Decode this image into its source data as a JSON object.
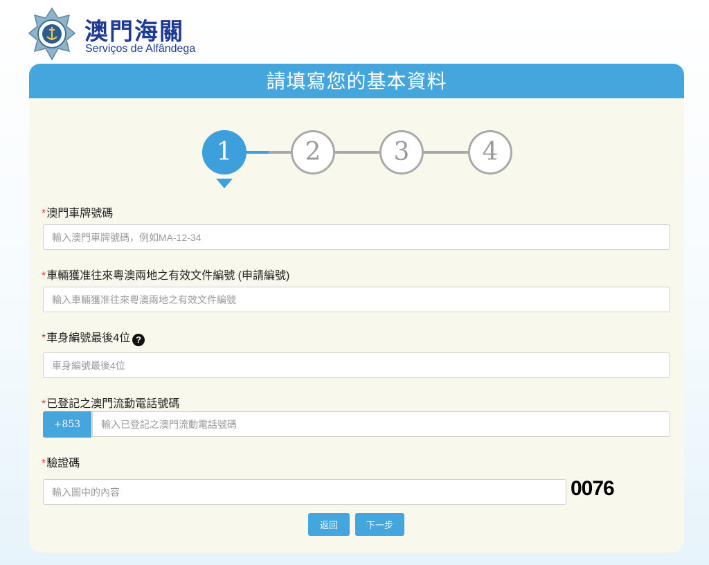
{
  "header": {
    "brand_zh": "澳門海關",
    "brand_pt": "Serviços de Alfândega"
  },
  "panel": {
    "title": "請填寫您的基本資料"
  },
  "steps": [
    "1",
    "2",
    "3",
    "4"
  ],
  "form": {
    "plate": {
      "required_mark": "*",
      "label": "澳門車牌號碼",
      "placeholder": "輸入澳門車牌號碼，例如MA-12-34",
      "value": ""
    },
    "permit": {
      "required_mark": "*",
      "label": "車輛獲准往來粵澳兩地之有效文件編號 (申請編號)",
      "placeholder": "輸入車輛獲准往來粵澳兩地之有效文件編號",
      "value": ""
    },
    "vin": {
      "required_mark": "*",
      "label": "車身編號最後4位",
      "help_icon": "?",
      "placeholder": "車身編號最後4位",
      "value": ""
    },
    "phone": {
      "required_mark": "*",
      "label": "已登記之澳門流動電話號碼",
      "prefix": "+853",
      "placeholder": "輸入已登記之澳門流動電話號碼",
      "value": ""
    },
    "captcha": {
      "required_mark": "*",
      "label": "驗證碼",
      "placeholder": "輸入圖中的內容",
      "value": "",
      "image_text": "0076"
    }
  },
  "buttons": {
    "back": "返回",
    "next": "下一步"
  },
  "colors": {
    "accent": "#45a6de",
    "brand": "#1f3a93",
    "required": "#e53935",
    "panel_bg": "#f8f8ec"
  }
}
